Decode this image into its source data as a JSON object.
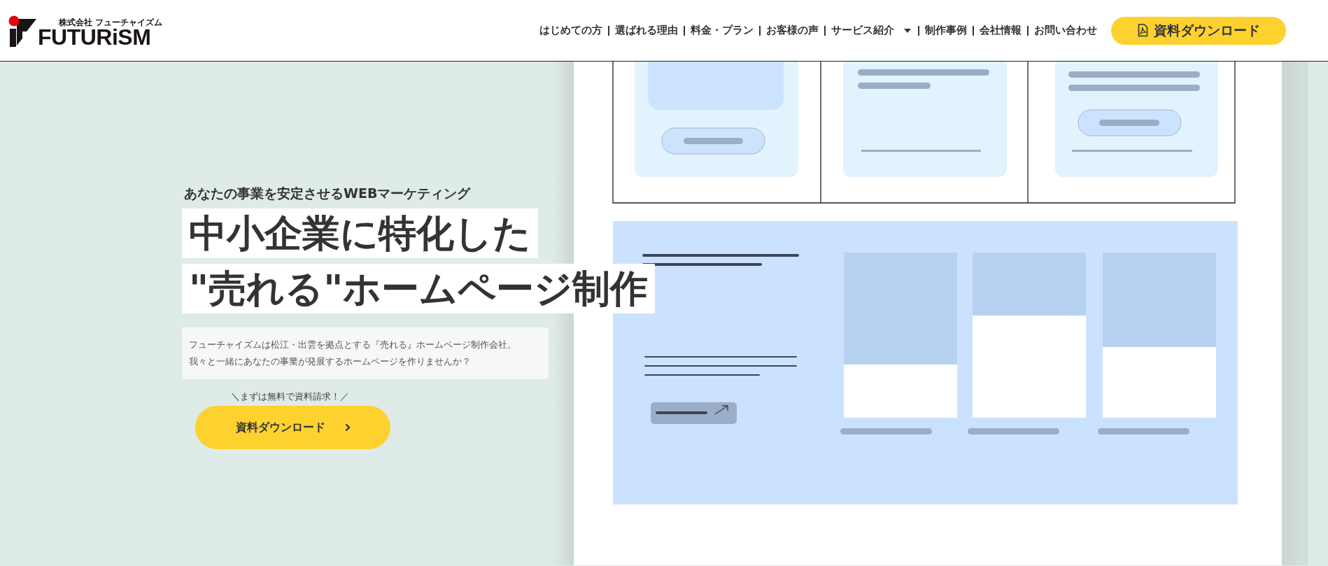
{
  "header": {
    "logo": {
      "company_prefix": "株式会社 フューチャイズム",
      "wordmark": "FUTURiSM"
    },
    "nav": [
      {
        "label": "はじめての方",
        "has_dropdown": false
      },
      {
        "label": "選ばれる理由",
        "has_dropdown": false
      },
      {
        "label": "料金・プラン",
        "has_dropdown": false
      },
      {
        "label": "お客様の声",
        "has_dropdown": false
      },
      {
        "label": "サービス紹介",
        "has_dropdown": true
      },
      {
        "label": "制作事例",
        "has_dropdown": false
      },
      {
        "label": "会社情報",
        "has_dropdown": false
      },
      {
        "label": "お問い合わせ",
        "has_dropdown": false
      }
    ],
    "cta": "資料ダウンロード"
  },
  "hero": {
    "tagline": "あなたの事業を安定させるWEBマーケティング",
    "headline_lines": [
      "中小企業に特化した",
      "\"売れる\"ホームページ制作"
    ],
    "intro_lines": [
      "フューチャイズムは松江・出雲を拠点とする『売れる』ホームページ制作会社。",
      "我々と一緒にあなたの事業が発展するホームページを作りませんか？"
    ],
    "cta_note": "＼まずは無料で資料請求！／",
    "cta_button": "資料ダウンロード"
  }
}
